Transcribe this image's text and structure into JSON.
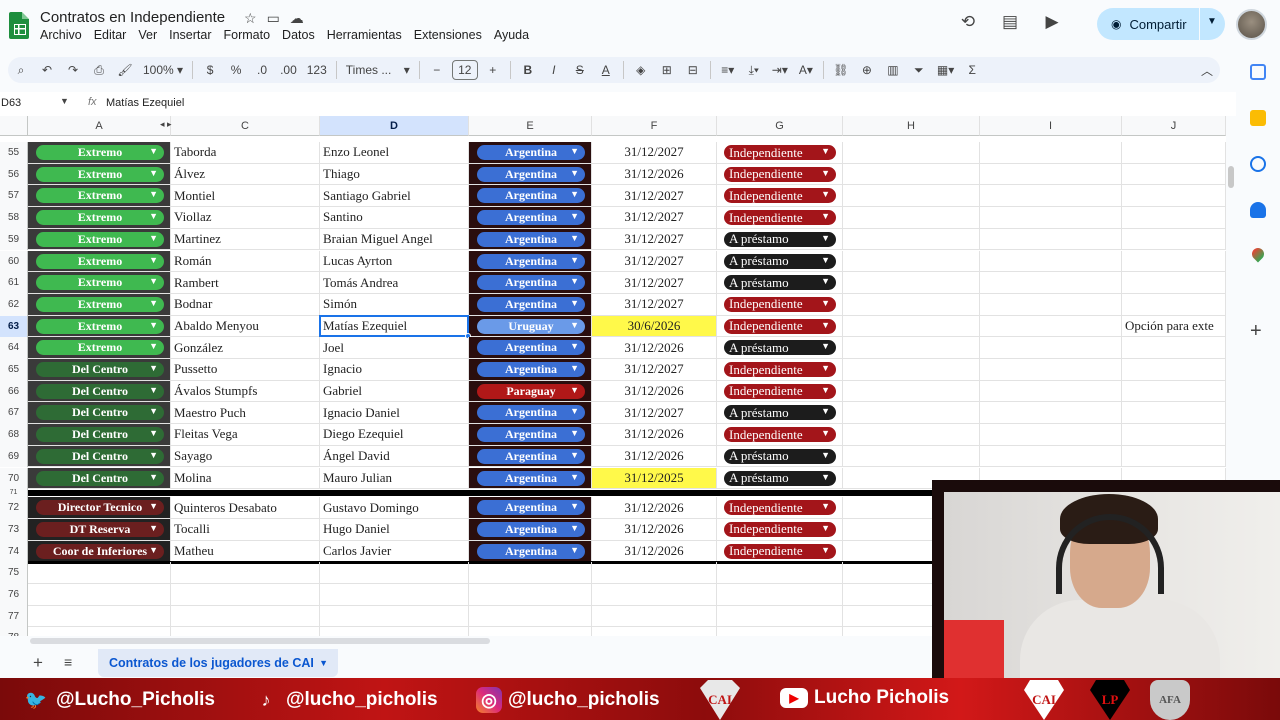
{
  "app": {
    "title": "Contratos en Independiente",
    "menu": [
      "Archivo",
      "Editar",
      "Ver",
      "Insertar",
      "Formato",
      "Datos",
      "Herramientas",
      "Extensiones",
      "Ayuda"
    ],
    "share_label": "Compartir"
  },
  "toolbar": {
    "zoom": "100%",
    "currency": "$",
    "percent": "%",
    "dec_less": ".0",
    "dec_more": ".00",
    "number_format": "123",
    "font": "Times ...",
    "font_size": "12"
  },
  "formula_bar": {
    "cell_ref": "D63",
    "fx": "fx",
    "value": "Matías Ezequiel"
  },
  "columns": [
    "A",
    "C",
    "D",
    "E",
    "F",
    "G",
    "H",
    "I",
    "J"
  ],
  "rows": [
    {
      "n": "55",
      "a": "Extremo",
      "c": "Taborda",
      "d": "Enzo Leonel",
      "e": "Argentina",
      "f": "31/12/2027",
      "g": "Independiente"
    },
    {
      "n": "56",
      "a": "Extremo",
      "c": "Álvez",
      "d": "Thiago",
      "e": "Argentina",
      "f": "31/12/2026",
      "g": "Independiente"
    },
    {
      "n": "57",
      "a": "Extremo",
      "c": "Montiel",
      "d": "Santiago Gabriel",
      "e": "Argentina",
      "f": "31/12/2027",
      "g": "Independiente"
    },
    {
      "n": "58",
      "a": "Extremo",
      "c": "Viollaz",
      "d": "Santino",
      "e": "Argentina",
      "f": "31/12/2027",
      "g": "Independiente"
    },
    {
      "n": "59",
      "a": "Extremo",
      "c": "Martinez",
      "d": "Braian Miguel Angel",
      "e": "Argentina",
      "f": "31/12/2027",
      "g": "A préstamo"
    },
    {
      "n": "60",
      "a": "Extremo",
      "c": "Román",
      "d": "Lucas Ayrton",
      "e": "Argentina",
      "f": "31/12/2027",
      "g": "A préstamo"
    },
    {
      "n": "61",
      "a": "Extremo",
      "c": "Rambert",
      "d": "Tomás Andrea",
      "e": "Argentina",
      "f": "31/12/2027",
      "g": "A préstamo"
    },
    {
      "n": "62",
      "a": "Extremo",
      "c": "Bodnar",
      "d": "Simón",
      "e": "Argentina",
      "f": "31/12/2027",
      "g": "Independiente"
    },
    {
      "n": "63",
      "a": "Extremo",
      "c": "Abaldo Menyou",
      "d": "Matías Ezequiel",
      "e": "Uruguay",
      "f": "30/6/2026",
      "g": "Independiente",
      "j": "Opción para exte"
    },
    {
      "n": "64",
      "a": "Extremo",
      "c": "González",
      "d": "Joel",
      "e": "Argentina",
      "f": "31/12/2026",
      "g": "A préstamo"
    },
    {
      "n": "65",
      "a": "Del Centro",
      "c": "Pussetto",
      "d": "Ignacio",
      "e": "Argentina",
      "f": "31/12/2027",
      "g": "Independiente"
    },
    {
      "n": "66",
      "a": "Del Centro",
      "c": "Ávalos Stumpfs",
      "d": "Gabriel",
      "e": "Paraguay",
      "f": "31/12/2026",
      "g": "Independiente"
    },
    {
      "n": "67",
      "a": "Del Centro",
      "c": "Maestro Puch",
      "d": "Ignacio Daniel",
      "e": "Argentina",
      "f": "31/12/2027",
      "g": "A préstamo"
    },
    {
      "n": "68",
      "a": "Del Centro",
      "c": "Fleitas Vega",
      "d": "Diego Ezequiel",
      "e": "Argentina",
      "f": "31/12/2026",
      "g": "Independiente"
    },
    {
      "n": "69",
      "a": "Del Centro",
      "c": "Sayago",
      "d": "Ángel David",
      "e": "Argentina",
      "f": "31/12/2026",
      "g": "A préstamo"
    },
    {
      "n": "70",
      "a": "Del Centro",
      "c": "Molina",
      "d": "Mauro Julian",
      "e": "Argentina",
      "f": "31/12/2025",
      "g": "A préstamo"
    },
    {
      "n": "71"
    },
    {
      "n": "72",
      "a": "Director Tecnico",
      "c": "Quinteros Desabato",
      "d": "Gustavo Domingo",
      "e": "Argentina",
      "f": "31/12/2026",
      "g": "Independiente"
    },
    {
      "n": "73",
      "a": "DT Reserva",
      "c": "Tocalli",
      "d": "Hugo Daniel",
      "e": "Argentina",
      "f": "31/12/2026",
      "g": "Independiente"
    },
    {
      "n": "74",
      "a": "Coor de Inferiores",
      "c": "Matheu",
      "d": "Carlos Javier",
      "e": "Argentina",
      "f": "31/12/2026",
      "g": "Independiente"
    },
    {
      "n": "75"
    },
    {
      "n": "76"
    },
    {
      "n": "77"
    },
    {
      "n": "78"
    }
  ],
  "colors": {
    "extremo": "#3fb950",
    "del_centro": "#2e6b35",
    "staff": "#6b1f1f",
    "argentina": "#3b6fd4",
    "uruguay": "#6a9ae8",
    "paraguay": "#b01818",
    "independiente": "#a3151a",
    "prestamo": "#1c1c1c",
    "highlight_yellow": "#fff94a"
  },
  "sheet_tab": "Contratos de los jugadores de CAI",
  "banner": {
    "twitter": "@Lucho_Picholis",
    "tiktok": "@lucho_picholis",
    "instagram": "@lucho_picholis",
    "youtube": "Lucho Picholis",
    "crest_cai": "CAI",
    "crest_lp": "LP",
    "crest_afa": "AFA"
  }
}
